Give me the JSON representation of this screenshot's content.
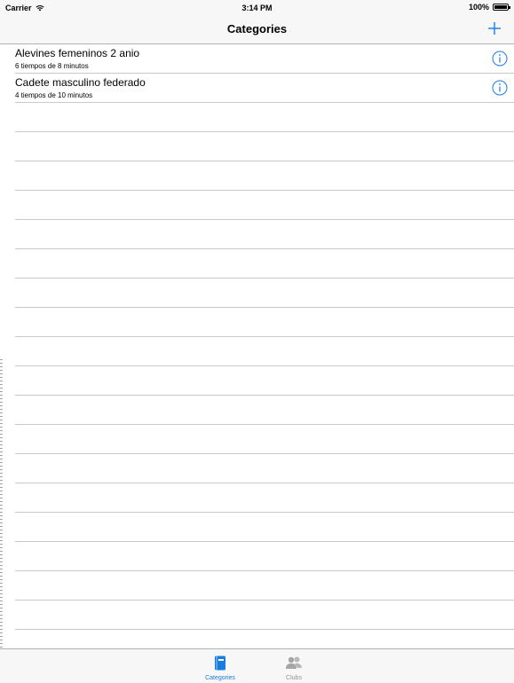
{
  "status_bar": {
    "carrier": "Carrier",
    "time": "3:14 PM",
    "battery": "100%",
    "battery_level": 1.0
  },
  "nav_bar": {
    "title": "Categories",
    "add_icon": "plus-icon"
  },
  "categories": [
    {
      "title": "Alevines femeninos 2 anio",
      "subtitle": "6 tiempos de 8 minutos",
      "icon": "info-icon"
    },
    {
      "title": "Cadete masculino federado",
      "subtitle": "4 tiempos de 10 minutos",
      "icon": "info-icon"
    }
  ],
  "tab_bar": {
    "tabs": [
      {
        "label": "Categories",
        "icon": "book-icon",
        "active": true
      },
      {
        "label": "Clubs",
        "icon": "people-icon",
        "active": false
      }
    ]
  },
  "colors": {
    "accent": "#1a7be0",
    "inactive": "#929292",
    "bar_bg": "#f7f7f7",
    "separator": "#c8c7cc"
  }
}
